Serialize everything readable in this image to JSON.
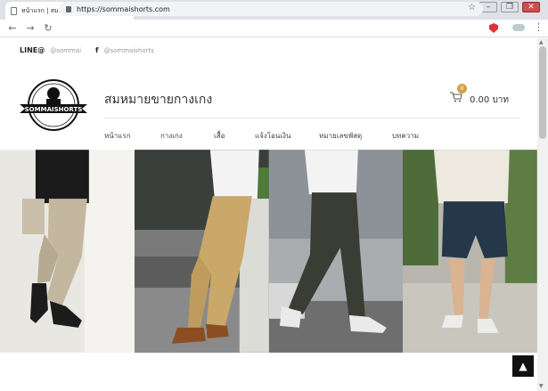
{
  "browser": {
    "tab_title": "หน้าแรก | สมหมายขายกางเกง",
    "url": "https://sommaishorts.com"
  },
  "social": {
    "line_brand": "LINE@",
    "line_handle": "@sommai",
    "facebook_icon_text": "f",
    "facebook_handle": "@sommaishorts"
  },
  "site": {
    "title": "สมหมายขายกางเกง",
    "logo_text": "SOMMAISHORTS"
  },
  "cart": {
    "count": "0",
    "total": "0.00 บาท"
  },
  "nav": [
    {
      "label": "หน้าแรก"
    },
    {
      "label": "กางเกง"
    },
    {
      "label": "เสื้อ"
    },
    {
      "label": "แจ้งโอนเงิน"
    },
    {
      "label": "หมายเลขพัสดุ"
    },
    {
      "label": "บทความ"
    }
  ],
  "colors": {
    "accent": "#d4a04a",
    "text": "#333333"
  }
}
